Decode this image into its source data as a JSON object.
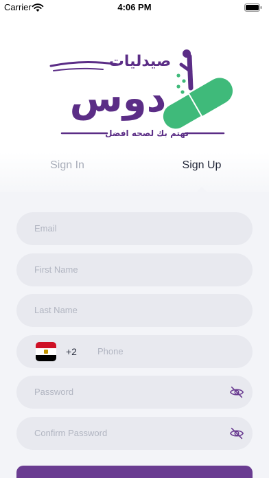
{
  "status_bar": {
    "carrier": "Carrier",
    "time": "4:06 PM"
  },
  "logo": {
    "brand_top": "صيدليات",
    "brand_main": "دوس",
    "tagline": "نهتم بك لصحه افضل",
    "colors": {
      "purple": "#5b2d86",
      "green": "#3fba7a"
    }
  },
  "tabs": [
    {
      "label": "Sign In",
      "active": false
    },
    {
      "label": "Sign Up",
      "active": true
    }
  ],
  "form": {
    "email_placeholder": "Email",
    "first_name_placeholder": "First Name",
    "last_name_placeholder": "Last Name",
    "phone": {
      "country_code": "+2",
      "placeholder": "Phone",
      "flag_icon": "egypt-flag-icon"
    },
    "password_placeholder": "Password",
    "confirm_password_placeholder": "Confirm Password",
    "visibility_icon": "eye-off-icon"
  },
  "colors": {
    "accent": "#6a3c91",
    "field_bg": "#e8e9ef",
    "form_bg": "#f3f4f8",
    "placeholder": "#b1b5c1"
  }
}
